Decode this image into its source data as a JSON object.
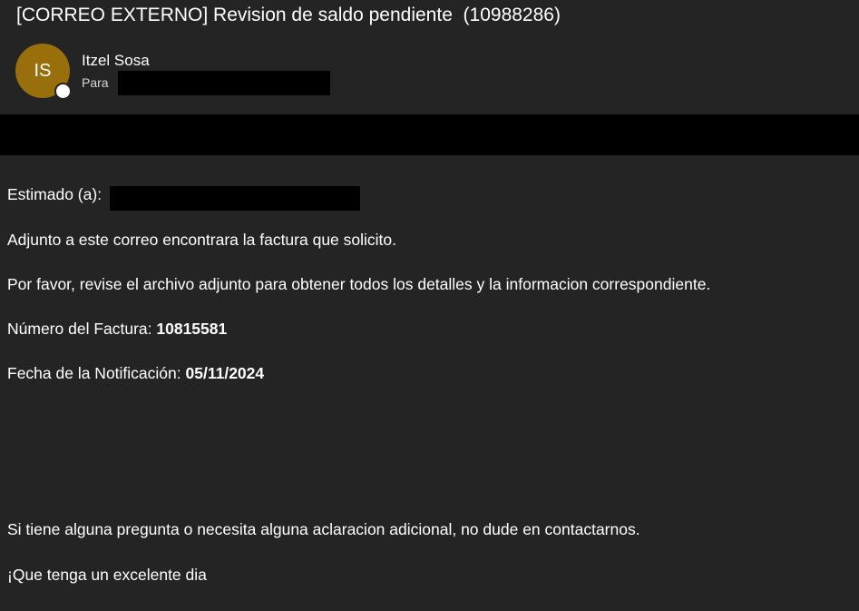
{
  "email": {
    "subject": "[CORREO EXTERNO] Revision de saldo pendiente  (10988286)",
    "sender": {
      "initials": "IS",
      "name": "Itzel Sosa",
      "avatar_color": "#986f0b"
    },
    "to_label": "Para",
    "body": {
      "greeting": "Estimado (a):",
      "line1": "Adjunto a este correo encontrara la factura que solicito.",
      "line2": "Por favor, revise el archivo adjunto para obtener todos los detalles y la informacion correspondiente.",
      "invoice_label": "Número del Factura: ",
      "invoice_number": "10815581",
      "date_label": "Fecha de la Notificación: ",
      "date_value": "05/11/2024",
      "line3": "Si tiene alguna pregunta o necesita alguna aclaracion adicional, no dude en contactarnos.",
      "closing": "¡Que tenga un excelente dia"
    }
  },
  "theme": {
    "background": "#242424",
    "redaction": "#000000"
  }
}
